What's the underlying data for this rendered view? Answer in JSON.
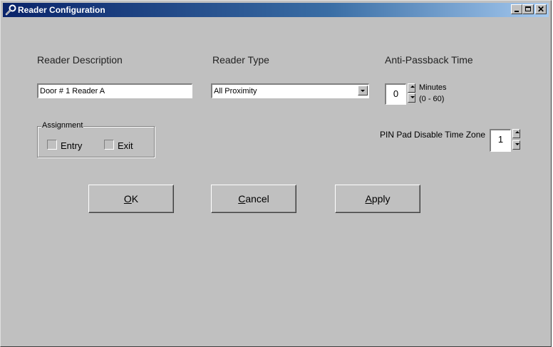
{
  "window": {
    "title": "Reader Configuration",
    "controls": [
      "minimize",
      "maximize",
      "close"
    ]
  },
  "reader_description": {
    "label": "Reader Description",
    "value": "Door # 1 Reader A"
  },
  "reader_type": {
    "label": "Reader Type",
    "selected": "All Proximity"
  },
  "anti_passback": {
    "label": "Anti-Passback Time",
    "value": "0",
    "unit": "Minutes",
    "range": "(0 - 60)"
  },
  "assignment": {
    "title": "Assignment",
    "entry_label": "Entry",
    "exit_label": "Exit"
  },
  "pin_pad": {
    "label": "PIN Pad Disable Time Zone",
    "value": "1"
  },
  "buttons": {
    "ok": {
      "mnemonic": "O",
      "rest": "K"
    },
    "cancel": {
      "mnemonic": "C",
      "rest": "ancel"
    },
    "apply": {
      "mnemonic": "A",
      "rest": "pply"
    }
  },
  "colors": {
    "title_start": "#0a246a",
    "title_end": "#a6caf0",
    "face": "#c0c0c0"
  }
}
